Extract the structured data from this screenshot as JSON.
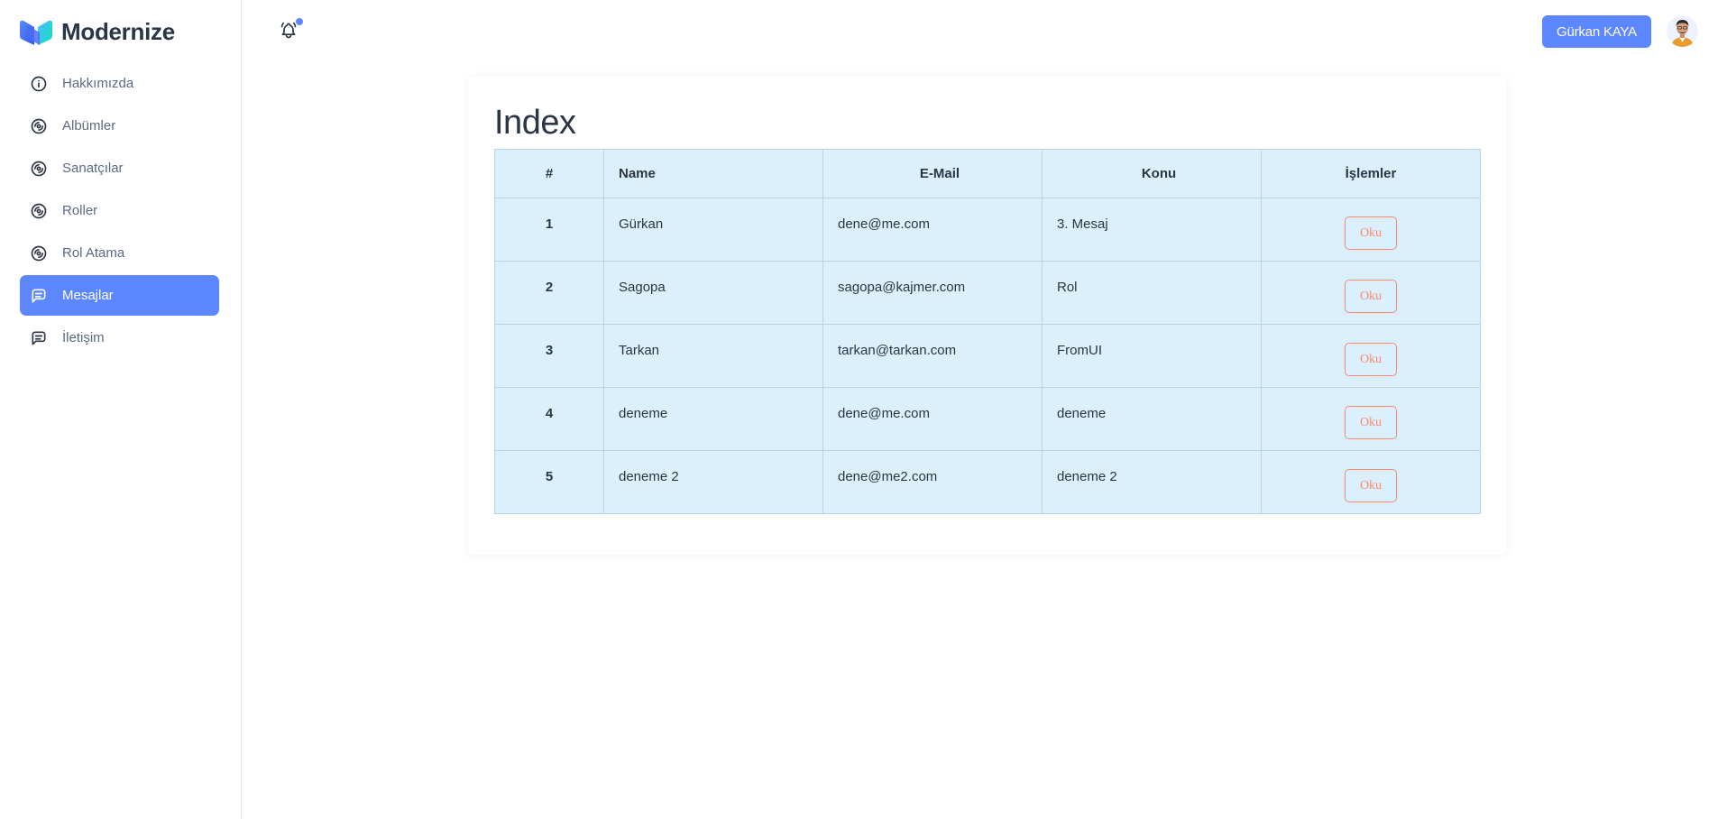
{
  "brand": {
    "name": "Modernize"
  },
  "sidebar": {
    "items": [
      {
        "label": "Hakkımızda",
        "icon": "info-circle-icon",
        "active": false
      },
      {
        "label": "Albümler",
        "icon": "disc-icon",
        "active": false
      },
      {
        "label": "Sanatçılar",
        "icon": "disc-icon",
        "active": false
      },
      {
        "label": "Roller",
        "icon": "disc-icon",
        "active": false
      },
      {
        "label": "Rol Atama",
        "icon": "disc-icon",
        "active": false
      },
      {
        "label": "Mesajlar",
        "icon": "message-icon",
        "active": true
      },
      {
        "label": "İletişim",
        "icon": "message-icon",
        "active": false
      }
    ]
  },
  "header": {
    "user_button": "Gürkan KAYA",
    "notification_icon": "bell-icon",
    "avatar_icon": "avatar-icon"
  },
  "main": {
    "title": "Index",
    "table": {
      "headers": [
        "#",
        "Name",
        "E-Mail",
        "Konu",
        "İşlemler"
      ],
      "rows": [
        {
          "num": "1",
          "name": "Gürkan",
          "email": "dene@me.com",
          "konu": "3. Mesaj",
          "action": "Oku"
        },
        {
          "num": "2",
          "name": "Sagopa",
          "email": "sagopa@kajmer.com",
          "konu": "Rol",
          "action": "Oku"
        },
        {
          "num": "3",
          "name": "Tarkan",
          "email": "tarkan@tarkan.com",
          "konu": "FromUI",
          "action": "Oku"
        },
        {
          "num": "4",
          "name": "deneme",
          "email": "dene@me.com",
          "konu": "deneme",
          "action": "Oku"
        },
        {
          "num": "5",
          "name": "deneme 2",
          "email": "dene@me2.com",
          "konu": "deneme 2",
          "action": "Oku"
        }
      ]
    }
  },
  "colors": {
    "accent": "#5d87ff",
    "table_bg": "#dbf0fc",
    "danger_outline": "#fa896b"
  }
}
